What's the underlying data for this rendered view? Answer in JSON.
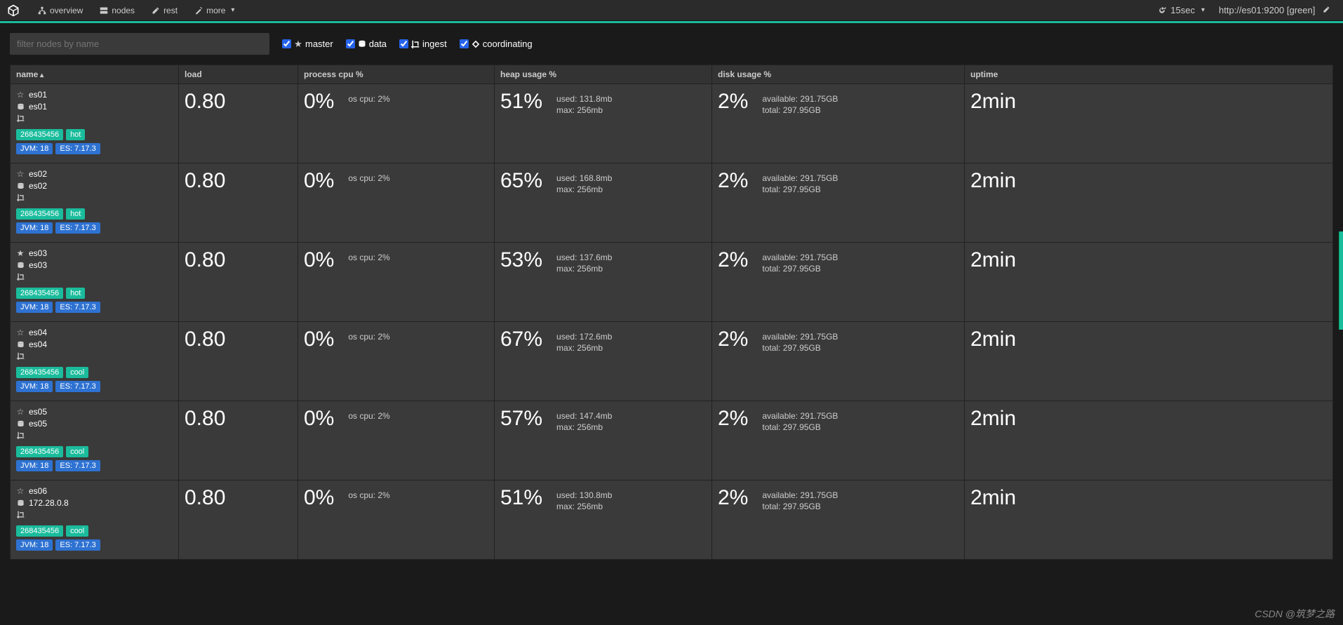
{
  "nav": {
    "overview": "overview",
    "nodes": "nodes",
    "rest": "rest",
    "more": "more"
  },
  "header": {
    "refresh": "15sec",
    "url": "http://es01:9200",
    "status": "[green]"
  },
  "filter": {
    "placeholder": "filter nodes by name",
    "master": "master",
    "data": "data",
    "ingest": "ingest",
    "coordinating": "coordinating"
  },
  "columns": {
    "name": "name",
    "load": "load",
    "cpu": "process cpu %",
    "heap": "heap usage %",
    "disk": "disk usage %",
    "uptime": "uptime"
  },
  "labels": {
    "os_cpu": "os cpu:",
    "used": "used:",
    "max": "max:",
    "available": "available:",
    "total": "total:",
    "jvm_prefix": "JVM:",
    "es_prefix": "ES:"
  },
  "watermark": "CSDN @筑梦之路",
  "nodes_list": [
    {
      "star": "☆",
      "name": "es01",
      "host": "es01",
      "master": false,
      "mem": "268435456",
      "tier": "hot",
      "jvm": "18",
      "es": "7.17.3",
      "load": "0.80",
      "cpu": "0%",
      "os_cpu": "2%",
      "heap": "51%",
      "heap_used": "131.8mb",
      "heap_max": "256mb",
      "disk": "2%",
      "disk_avail": "291.75GB",
      "disk_total": "297.95GB",
      "uptime": "2min"
    },
    {
      "star": "☆",
      "name": "es02",
      "host": "es02",
      "master": false,
      "mem": "268435456",
      "tier": "hot",
      "jvm": "18",
      "es": "7.17.3",
      "load": "0.80",
      "cpu": "0%",
      "os_cpu": "2%",
      "heap": "65%",
      "heap_used": "168.8mb",
      "heap_max": "256mb",
      "disk": "2%",
      "disk_avail": "291.75GB",
      "disk_total": "297.95GB",
      "uptime": "2min"
    },
    {
      "star": "★",
      "name": "es03",
      "host": "es03",
      "master": true,
      "mem": "268435456",
      "tier": "hot",
      "jvm": "18",
      "es": "7.17.3",
      "load": "0.80",
      "cpu": "0%",
      "os_cpu": "2%",
      "heap": "53%",
      "heap_used": "137.6mb",
      "heap_max": "256mb",
      "disk": "2%",
      "disk_avail": "291.75GB",
      "disk_total": "297.95GB",
      "uptime": "2min"
    },
    {
      "star": "☆",
      "name": "es04",
      "host": "es04",
      "master": false,
      "mem": "268435456",
      "tier": "cool",
      "jvm": "18",
      "es": "7.17.3",
      "load": "0.80",
      "cpu": "0%",
      "os_cpu": "2%",
      "heap": "67%",
      "heap_used": "172.6mb",
      "heap_max": "256mb",
      "disk": "2%",
      "disk_avail": "291.75GB",
      "disk_total": "297.95GB",
      "uptime": "2min"
    },
    {
      "star": "☆",
      "name": "es05",
      "host": "es05",
      "master": false,
      "mem": "268435456",
      "tier": "cool",
      "jvm": "18",
      "es": "7.17.3",
      "load": "0.80",
      "cpu": "0%",
      "os_cpu": "2%",
      "heap": "57%",
      "heap_used": "147.4mb",
      "heap_max": "256mb",
      "disk": "2%",
      "disk_avail": "291.75GB",
      "disk_total": "297.95GB",
      "uptime": "2min"
    },
    {
      "star": "☆",
      "name": "es06",
      "host": "172.28.0.8",
      "master": false,
      "mem": "268435456",
      "tier": "cool",
      "jvm": "18",
      "es": "7.17.3",
      "load": "0.80",
      "cpu": "0%",
      "os_cpu": "2%",
      "heap": "51%",
      "heap_used": "130.8mb",
      "heap_max": "256mb",
      "disk": "2%",
      "disk_avail": "291.75GB",
      "disk_total": "297.95GB",
      "uptime": "2min"
    }
  ]
}
